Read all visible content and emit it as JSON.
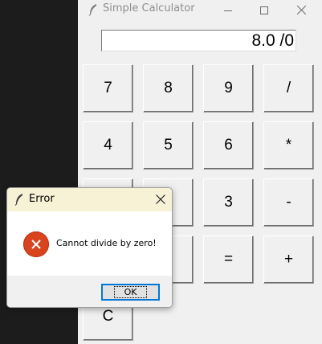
{
  "calculator": {
    "title": "Simple Calculator",
    "display_value": "8.0 /0",
    "window_controls": {
      "minimize_icon": "minimize-icon",
      "maximize_icon": "maximize-icon",
      "close_icon": "close-icon"
    },
    "keys": [
      {
        "label": "7"
      },
      {
        "label": "8"
      },
      {
        "label": "9"
      },
      {
        "label": "/"
      },
      {
        "label": "4"
      },
      {
        "label": "5"
      },
      {
        "label": "6"
      },
      {
        "label": "*"
      },
      {
        "label": "3"
      },
      {
        "label": "-"
      },
      {
        "label": "="
      },
      {
        "label": "+"
      },
      {
        "label": "C"
      }
    ]
  },
  "error_dialog": {
    "title": "Error",
    "message": "Cannot divide by zero!",
    "ok_label": "OK",
    "icon": "error-icon",
    "accent": "#d9441f"
  }
}
